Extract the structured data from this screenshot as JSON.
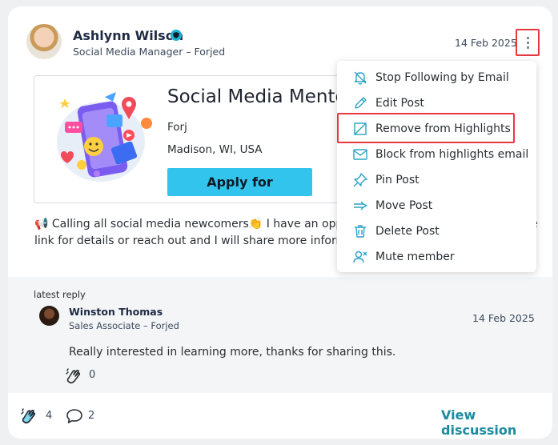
{
  "post": {
    "author_name": "Ashlynn Wilson",
    "author_role": "Social Media Manager – Forjed",
    "date": "14 Feb 2025",
    "body": "📢 Calling all social media newcomers👏 I have an opportunity for mentorship. Follow the link for details or reach out and I will share more information!"
  },
  "mentorship": {
    "title": "Social Media Mentorship",
    "organization": "Forj",
    "location": "Madison, WI, USA",
    "apply_label": "Apply for Mentorship"
  },
  "menu": {
    "items": [
      {
        "label": "Stop Following by Email",
        "icon": "bell-off-icon"
      },
      {
        "label": "Edit Post",
        "icon": "pencil-icon"
      },
      {
        "label": "Remove from Highlights",
        "icon": "highlight-off-icon"
      },
      {
        "label": "Block from highlights email",
        "icon": "mail-icon"
      },
      {
        "label": "Pin Post",
        "icon": "pin-icon"
      },
      {
        "label": "Move Post",
        "icon": "arrow-right-icon"
      },
      {
        "label": "Delete Post",
        "icon": "trash-icon"
      },
      {
        "label": "Mute member",
        "icon": "user-mute-icon"
      }
    ]
  },
  "reply": {
    "label": "latest reply",
    "author_name": "Winston Thomas",
    "author_role": "Sales Associate – Forjed",
    "date": "14 Feb 2025",
    "text": "Really interested in learning more, thanks for sharing this.",
    "clap_count": "0"
  },
  "footer": {
    "clap_count": "4",
    "comment_count": "2",
    "view_label": "View discussion"
  },
  "colors": {
    "accent": "#33c4ee",
    "link": "#1b8a9e",
    "highlight_border": "#e5393f",
    "icon": "#2ba3c4"
  }
}
